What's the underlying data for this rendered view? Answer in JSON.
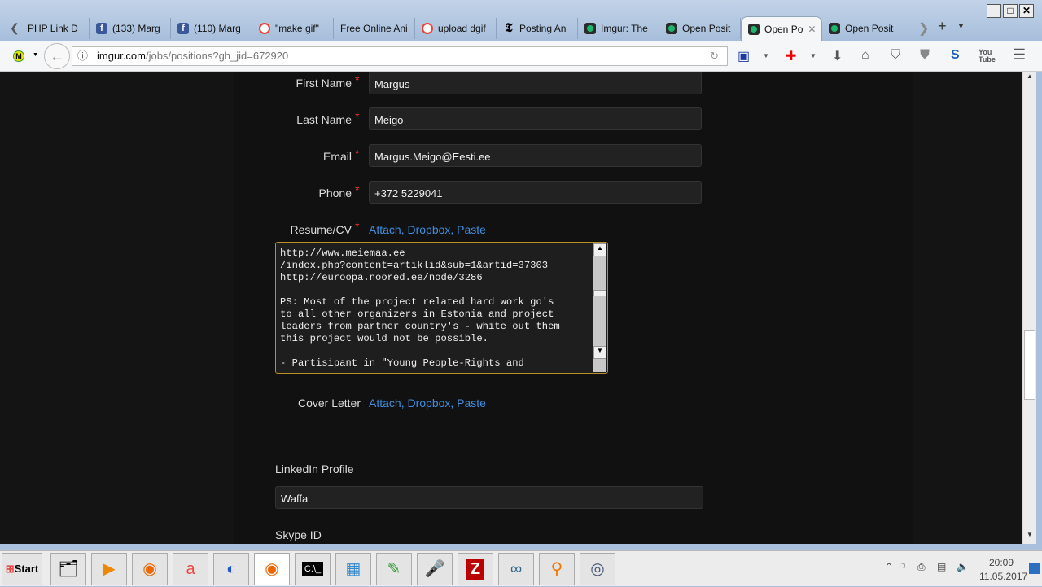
{
  "browser": {
    "tabs": [
      {
        "label": "PHP Link D",
        "icon": "page-icon"
      },
      {
        "label": "(133) Marg",
        "icon": "facebook-icon"
      },
      {
        "label": "(110) Marg",
        "icon": "facebook-icon"
      },
      {
        "label": "\"make gif\"",
        "icon": "google-icon"
      },
      {
        "label": "Free Online Ani",
        "icon": "none"
      },
      {
        "label": "upload dgif",
        "icon": "google-icon"
      },
      {
        "label": "Posting An",
        "icon": "nyt-icon"
      },
      {
        "label": "Imgur: The",
        "icon": "imgur-icon"
      },
      {
        "label": "Open Posit",
        "icon": "imgur-icon"
      },
      {
        "label": "Open Po",
        "icon": "imgur-icon",
        "active": true
      },
      {
        "label": "Open Posit",
        "icon": "imgur-icon"
      }
    ],
    "url_domain": "imgur.com",
    "url_path": "/jobs/positions?gh_jid=672920"
  },
  "form": {
    "first_name": {
      "label": "First Name",
      "value": "Margus",
      "required": "*"
    },
    "last_name": {
      "label": "Last Name",
      "value": "Meigo",
      "required": "*"
    },
    "email": {
      "label": "Email",
      "value": "Margus.Meigo@Eesti.ee",
      "required": "*"
    },
    "phone": {
      "label": "Phone",
      "value": "+372 5229041",
      "required": "*"
    },
    "resume": {
      "label": "Resume/CV",
      "required": "*",
      "options": "Attach, Dropbox, Paste",
      "text": "http://www.meiemaa.ee\n/index.php?content=artiklid&sub=1&artid=37303\nhttp://euroopa.noored.ee/node/3286\n\nPS: Most of the project related hard work go's\nto all other organizers in Estonia and project\nleaders from partner country's - white out them\nthis project would not be possible.\n\n- Partisipant in \"Young People-Rights and"
    },
    "cover_letter": {
      "label": "Cover Letter",
      "options": "Attach, Dropbox, Paste"
    },
    "linkedin": {
      "label": "LinkedIn Profile",
      "value": "Waffa"
    },
    "skype": {
      "label": "Skype ID"
    }
  },
  "taskbar": {
    "start": "Start",
    "time": "20:09",
    "date": "11.05.2017"
  }
}
